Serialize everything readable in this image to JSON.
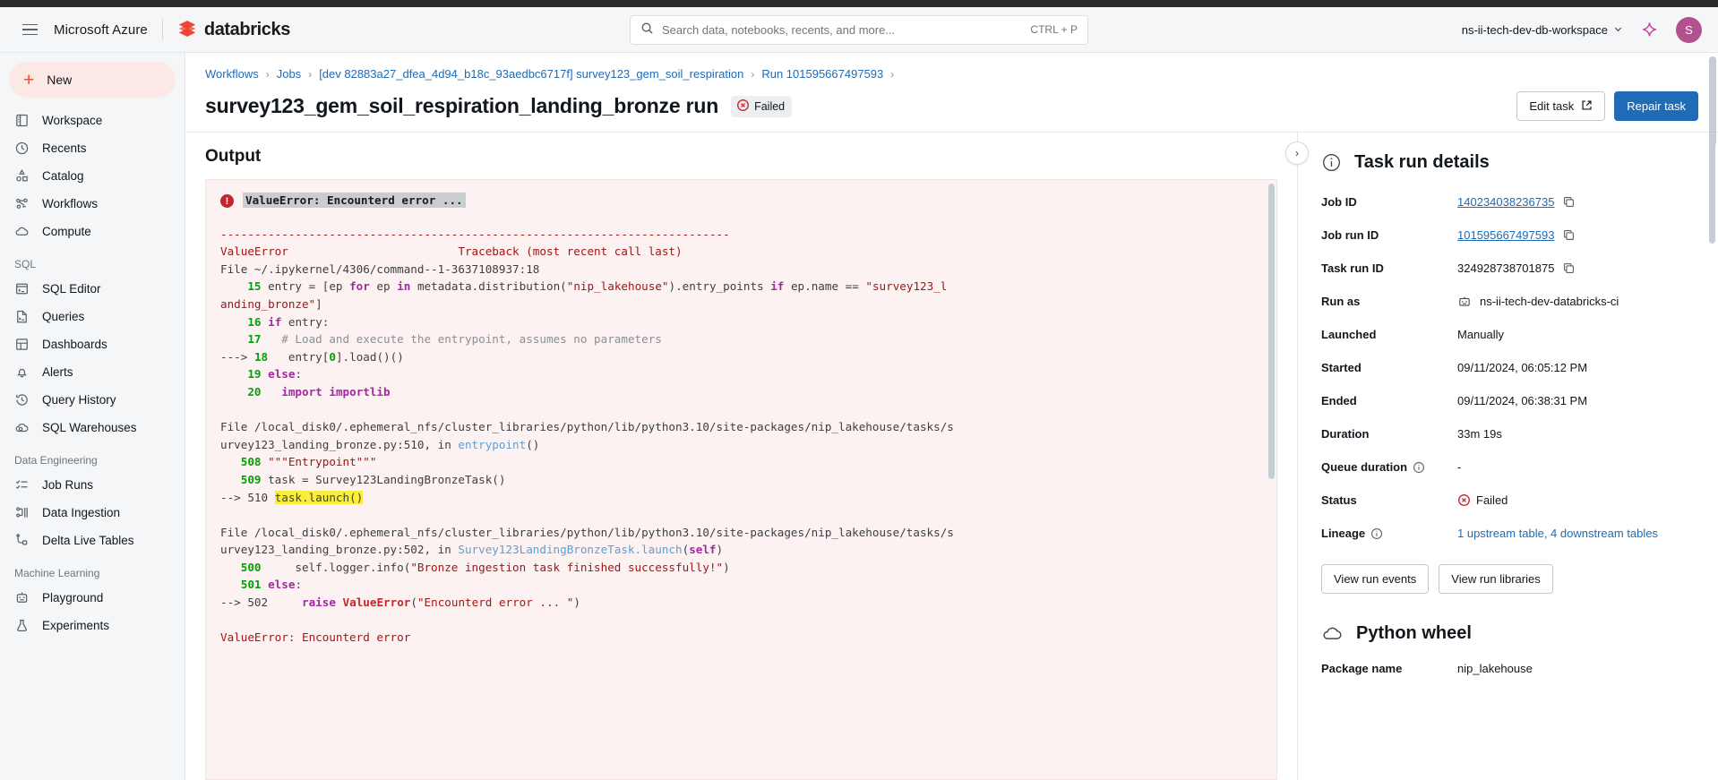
{
  "header": {
    "azure_label": "Microsoft Azure",
    "brand_name": "databricks",
    "search_placeholder": "Search data, notebooks, recents, and more...",
    "search_shortcut": "CTRL + P",
    "workspace": "ns-ii-tech-dev-db-workspace",
    "avatar_initial": "S"
  },
  "sidebar": {
    "new_label": "New",
    "items": [
      {
        "label": "Workspace",
        "icon": "workspace-icon"
      },
      {
        "label": "Recents",
        "icon": "clock-icon"
      },
      {
        "label": "Catalog",
        "icon": "catalog-icon"
      },
      {
        "label": "Workflows",
        "icon": "workflows-icon"
      },
      {
        "label": "Compute",
        "icon": "cloud-icon"
      }
    ],
    "sections": [
      {
        "label": "SQL",
        "items": [
          {
            "label": "SQL Editor",
            "icon": "sql-editor-icon"
          },
          {
            "label": "Queries",
            "icon": "queries-icon"
          },
          {
            "label": "Dashboards",
            "icon": "dashboards-icon"
          },
          {
            "label": "Alerts",
            "icon": "bell-icon"
          },
          {
            "label": "Query History",
            "icon": "history-icon"
          },
          {
            "label": "SQL Warehouses",
            "icon": "warehouse-icon"
          }
        ]
      },
      {
        "label": "Data Engineering",
        "items": [
          {
            "label": "Job Runs",
            "icon": "job-runs-icon"
          },
          {
            "label": "Data Ingestion",
            "icon": "data-ingestion-icon"
          },
          {
            "label": "Delta Live Tables",
            "icon": "delta-live-tables-icon"
          }
        ]
      },
      {
        "label": "Machine Learning",
        "items": [
          {
            "label": "Playground",
            "icon": "robot-icon"
          },
          {
            "label": "Experiments",
            "icon": "experiments-icon"
          }
        ]
      }
    ]
  },
  "breadcrumb": [
    "Workflows",
    "Jobs",
    "[dev 82883a27_dfea_4d94_b18c_93aedbc6717f] survey123_gem_soil_respiration",
    "Run 101595667497593"
  ],
  "page": {
    "title": "survey123_gem_soil_respiration_landing_bronze run",
    "status_badge": "Failed",
    "edit_task_label": "Edit task",
    "repair_task_label": "Repair task"
  },
  "output": {
    "title": "Output",
    "error_headline": "ValueError: Encounterd error ...",
    "separator": "---------------------------------------------------------------------------",
    "exception_name": "ValueError",
    "traceback_note": "Traceback (most recent call last)",
    "frames": [
      {
        "file": "File ~/.ipykernel/4306/command--1-3637108937:18",
        "lines": [
          {
            "num": "15",
            "marker": "",
            "code": "entry = [ep for ep in metadata.distribution(\"nip_lakehouse\").entry_points if ep.name == \"survey123_landing_bronze\"]"
          },
          {
            "num": "16",
            "marker": "",
            "code": "if entry:"
          },
          {
            "num": "17",
            "marker": "",
            "code": "  # Load and execute the entrypoint, assumes no parameters"
          },
          {
            "num": "18",
            "marker": "--->",
            "code": "  entry[0].load()()"
          },
          {
            "num": "19",
            "marker": "",
            "code": "else:"
          },
          {
            "num": "20",
            "marker": "",
            "code": "  import importlib"
          }
        ]
      },
      {
        "file": "File /local_disk0/.ephemeral_nfs/cluster_libraries/python/lib/python3.10/site-packages/nip_lakehouse/tasks/survey123_landing_bronze.py:510, in entrypoint()",
        "lines": [
          {
            "num": "508",
            "marker": "",
            "code": "\"\"\"Entrypoint\"\"\""
          },
          {
            "num": "509",
            "marker": "",
            "code": "task = Survey123LandingBronzeTask()"
          },
          {
            "num": "510",
            "marker": "-->",
            "code": "task.launch()"
          }
        ]
      },
      {
        "file": "File /local_disk0/.ephemeral_nfs/cluster_libraries/python/lib/python3.10/site-packages/nip_lakehouse/tasks/survey123_landing_bronze.py:502, in Survey123LandingBronzeTask.launch(self)",
        "lines": [
          {
            "num": "500",
            "marker": "",
            "code": "    self.logger.info(\"Bronze ingestion task finished successfully!\")"
          },
          {
            "num": "501",
            "marker": "",
            "code": "else:"
          },
          {
            "num": "502",
            "marker": "-->",
            "code": "    raise ValueError(\"Encounterd error ... \")"
          }
        ]
      }
    ],
    "trailing": "ValueError: Encounterd error"
  },
  "task_run_details": {
    "title": "Task run details",
    "rows": [
      {
        "key": "Job ID",
        "value": "140234038236735",
        "link": true,
        "copy": true
      },
      {
        "key": "Job run ID",
        "value": "101595667497593",
        "link": true,
        "copy": true
      },
      {
        "key": "Task run ID",
        "value": "324928738701875",
        "link": false,
        "copy": true
      },
      {
        "key": "Run as",
        "value": "ns-ii-tech-dev-databricks-ci",
        "link": false,
        "copy": false,
        "icon": "robot-icon"
      },
      {
        "key": "Launched",
        "value": "Manually",
        "link": false,
        "copy": false
      },
      {
        "key": "Started",
        "value": "09/11/2024, 06:05:12 PM",
        "link": false,
        "copy": false
      },
      {
        "key": "Ended",
        "value": "09/11/2024, 06:38:31 PM",
        "link": false,
        "copy": false
      },
      {
        "key": "Duration",
        "value": "33m 19s",
        "link": false,
        "copy": false
      },
      {
        "key": "Queue duration",
        "value": "-",
        "link": false,
        "copy": false,
        "key_info": true
      },
      {
        "key": "Status",
        "value": "Failed",
        "link": false,
        "copy": false,
        "status": true
      },
      {
        "key": "Lineage",
        "value": "1 upstream table, 4 downstream tables",
        "link": true,
        "copy": false,
        "key_info": true
      }
    ],
    "view_run_events_label": "View run events",
    "view_run_libraries_label": "View run libraries"
  },
  "python_wheel": {
    "title": "Python wheel",
    "package_key": "Package name",
    "package_value": "nip_lakehouse"
  },
  "colors": {
    "accent_blue": "#1f6bb5",
    "brand_red": "#e8533b",
    "fail_red": "#c4262e",
    "avatar": "#b3518c",
    "highlight_yellow": "#f9ef3a"
  }
}
